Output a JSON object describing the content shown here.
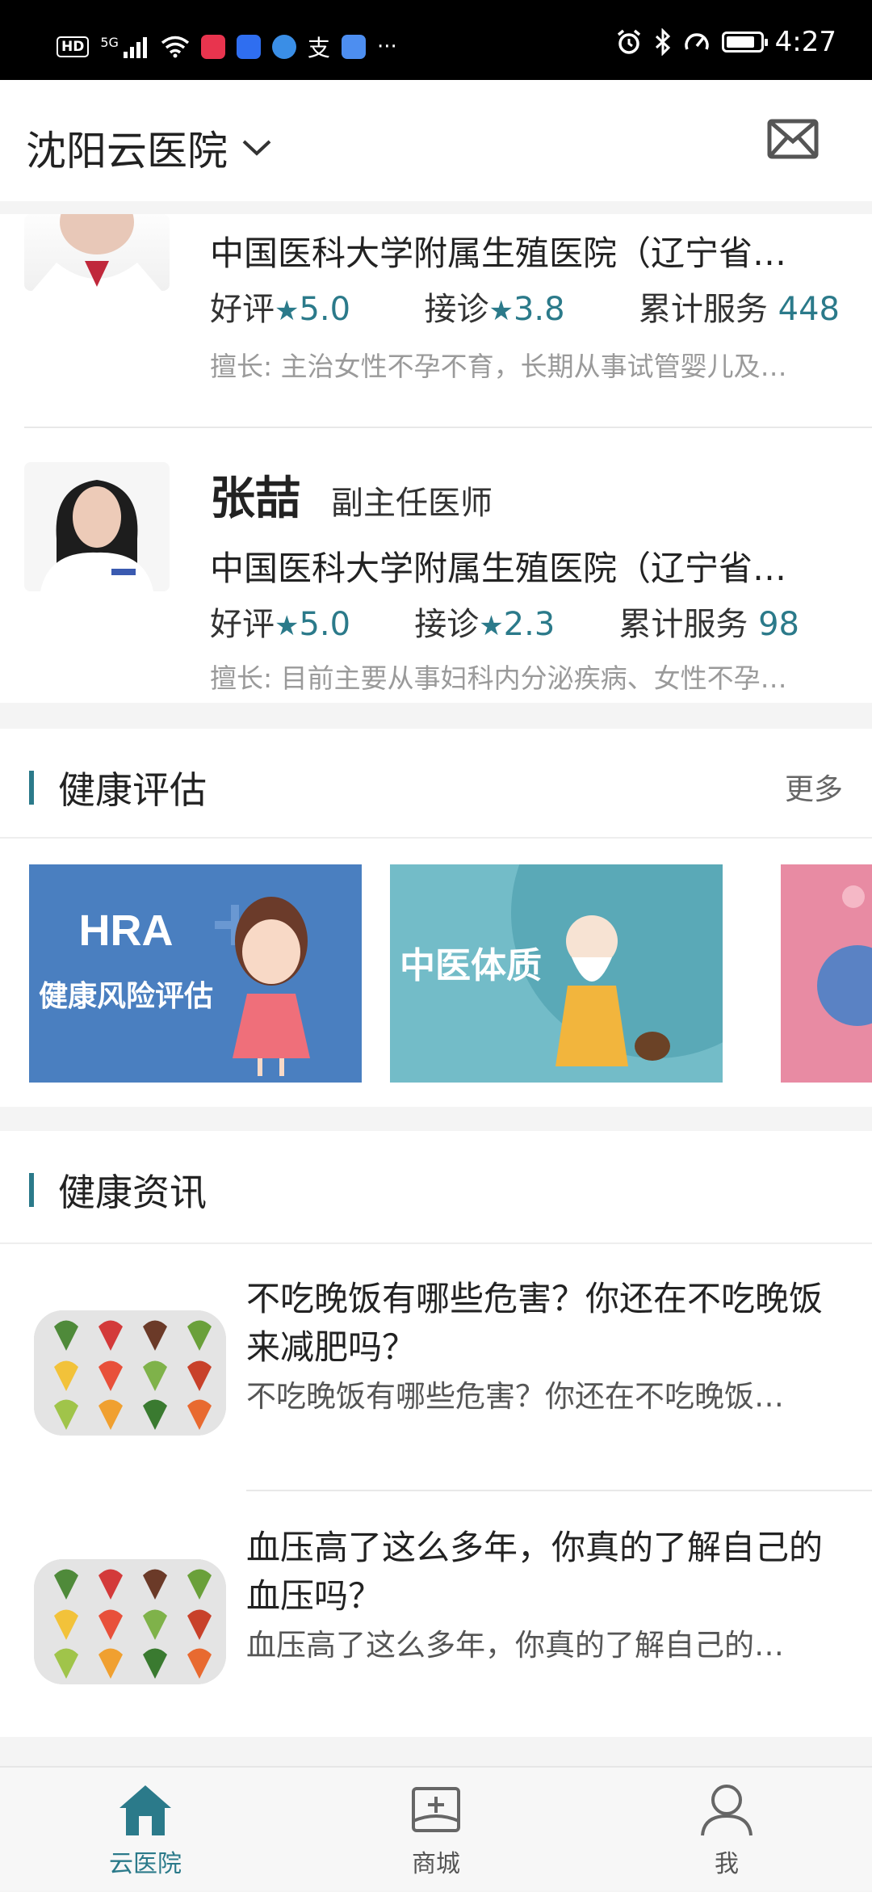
{
  "status_bar": {
    "hd": "HD",
    "net": "5G",
    "more": "···",
    "time": "4:27",
    "battery": 0.85
  },
  "header": {
    "city": "沈阳云医院"
  },
  "doctors": [
    {
      "name": "",
      "title": "",
      "hospital": "中国医科大学附属生殖医院（辽宁省…",
      "good_label": "好评",
      "good": "5.0",
      "consult_label": "接诊",
      "consult": "3.8",
      "served_label": "累计服务",
      "served": "448",
      "skill": "擅长: 主治女性不孕不育，长期从事试管婴儿及…"
    },
    {
      "name": "张喆",
      "title": "副主任医师",
      "hospital": "中国医科大学附属生殖医院（辽宁省…",
      "good_label": "好评",
      "good": "5.0",
      "consult_label": "接诊",
      "consult": "2.3",
      "served_label": "累计服务",
      "served": "98",
      "skill": "擅长: 目前主要从事妇科内分泌疾病、女性不孕…"
    }
  ],
  "assessment": {
    "title": "健康评估",
    "more": "更多",
    "banners": [
      {
        "line1": "HRA",
        "line2": "健康风险评估",
        "color": "#4a7fc0"
      },
      {
        "line1": "中医体质",
        "color": "#73bcc8"
      },
      {
        "line1": "",
        "color": "#e88ba3"
      }
    ]
  },
  "news": {
    "title": "健康资讯",
    "items": [
      {
        "title": "不吃晚饭有哪些危害？你还在不吃晚饭来减肥吗？",
        "summary": "不吃晚饭有哪些危害？你还在不吃晚饭…"
      },
      {
        "title": "血压高了这么多年，你真的了解自己的血压吗？",
        "summary": "血压高了这么多年，你真的了解自己的…"
      }
    ]
  },
  "tabbar": {
    "items": [
      {
        "label": "云医院",
        "active": true
      },
      {
        "label": "商城",
        "active": false
      },
      {
        "label": "我",
        "active": false
      }
    ],
    "accent": "#2b7a8a"
  }
}
